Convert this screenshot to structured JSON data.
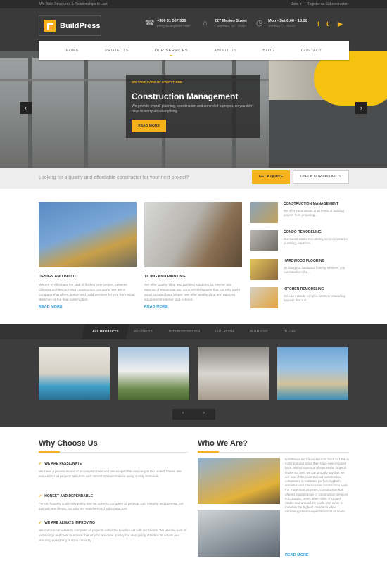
{
  "topbar": {
    "tagline": "We Build Structures & Relationships to Last",
    "jobs": "Jobs ▾",
    "register": "Register as Subcontractor"
  },
  "brand": {
    "name": "BuildPress",
    "accent": "#f5b21b"
  },
  "header": {
    "phone": {
      "icon": "phone-icon",
      "line1": "+386 31 567 536",
      "line2": "info@buildpress.com"
    },
    "address": {
      "icon": "home-icon",
      "line1": "227 Marion Street",
      "line2": "Columbia, SC 29201"
    },
    "hours": {
      "icon": "clock-icon",
      "line1": "Mon - Sat 8.00 - 18.00",
      "line2": "Sunday CLOSED"
    },
    "social": [
      "f",
      "t",
      "▶"
    ]
  },
  "nav": [
    "HOME",
    "PROJECTS",
    "OUR SERVICES",
    "ABOUT US",
    "BLOG",
    "CONTACT"
  ],
  "hero": {
    "small": "WE TAKE CARE OF EVERYTHING",
    "title": "Construction Management",
    "desc": "We provide overall planning, coordination and control of a project, so you don't have to worry about anything.",
    "button": "READ MORE",
    "prev": "‹",
    "next": "›"
  },
  "cta": {
    "question": "Looking for a quality and affordable constructor for your next project?",
    "quote_btn": "GET A QUOTE",
    "projects_btn": "CHECK OUR PROJECTS"
  },
  "services": [
    {
      "title": "DESIGN AND BUILD",
      "text": "We are to eliminate the task of finding your project between different architecture and construction company. We are a company that offers design and build services for you from initial sketches to the final construction.",
      "more": "READ MORE"
    },
    {
      "title": "TILING AND PAINTING",
      "text": "We offer quality tiling and painting solutions for interior and exterior of residential and commercial spaces that not only looks good but also lasts longer. We offer quality tiling and painting solutions for interior and exterior.",
      "more": "READ MORE"
    }
  ],
  "side_services": [
    {
      "title": "CONSTRUCTION MANAGEMENT",
      "text": "We offer commitment at all levels of building project, from preparing..."
    },
    {
      "title": "CONDO REMODELING",
      "text": "Our sound condo remodeling services includes plumbing, electrical..."
    },
    {
      "title": "HARDWOOD FLOORING",
      "text": "By fitting our hardwood flooring services, you can transform the..."
    },
    {
      "title": "KITCHEN REMODELING",
      "text": "We can execute complex kitchen remodelling projects that suit..."
    }
  ],
  "portfolio": {
    "tabs": [
      "ALL PROJECTS",
      "BUILDINGS",
      "INTERIOR DESIGN",
      "ISOLATION",
      "PLUMBING",
      "TILING"
    ],
    "prev": "‹",
    "next": "›"
  },
  "why": {
    "title": "Why Choose Us",
    "items": [
      {
        "title": "WE ARE PASSIONATE",
        "text": "We have a proven record of accomplishment and are a reputable company in the United States. We ensure that all projects are done with utmost professionalism using quality materials."
      },
      {
        "title": "HONEST AND DEPENDABLE",
        "text": "For us, honesty is the only policy and we strive to complete all projects with integrity and fairness, not just with our clients, but also our suppliers and subcontractors."
      },
      {
        "title": "WE ARE ALWAYS IMPROVING",
        "text": "We commit ourselves to complete all projects within the timeline set with our clients. We use the best of technology and tools to ensure that all jobs are done quickly but also giving attention to details and ensuring everything is done correctly."
      }
    ]
  },
  "who": {
    "title": "Who We Are?",
    "text": "BuildPress Inc traces its roots back to 1996 in Colorado and since then have never looked back. With thousands of successful projects under our belt, we can proudly say that we are one of the most trusted construction companies in Colorado performing both domestic and international construction work. For more than 25 years, Construction has offered a wide range of construction services in Colorado, many other cities of United States and around the world. We strive to maintain the highest standards while exceeding client's expectations at all levels.",
    "more": "READ MORE"
  }
}
